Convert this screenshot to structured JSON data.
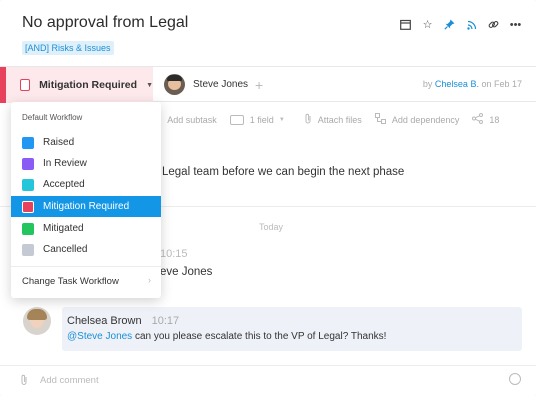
{
  "task": {
    "title": "No approval from Legal",
    "tag": "[AND] Risks & Issues",
    "description": "Legal team before we can begin the next phase"
  },
  "header_icons": [
    "calendar-icon",
    "star-icon",
    "pin-icon",
    "rss-icon",
    "link-icon",
    "more-icon"
  ],
  "status": {
    "label": "Mitigation Required",
    "color": "#e8415b"
  },
  "assignee": {
    "name": "Steve Jones"
  },
  "meta": {
    "prefix": "by",
    "author": "Chelsea B.",
    "date": "on Feb 17"
  },
  "toolbar": {
    "add_subtask": "Add subtask",
    "files": "1 field",
    "attach": "Attach files",
    "dependency": "Add dependency",
    "count": "18"
  },
  "dropdown": {
    "heading": "Default Workflow",
    "options": [
      {
        "label": "Raised",
        "color": "#2196f3"
      },
      {
        "label": "In Review",
        "color": "#8a5cf5"
      },
      {
        "label": "Accepted",
        "color": "#26c6da"
      },
      {
        "label": "Mitigation Required",
        "color": "#e8415b"
      },
      {
        "label": "Mitigated",
        "color": "#22c55e"
      },
      {
        "label": "Cancelled",
        "color": "#c4c9d4"
      }
    ],
    "change": "Change Task Workflow"
  },
  "timeline": {
    "day_label": "Today",
    "prev_time": "10:15",
    "prev_name": "eve Jones"
  },
  "comment": {
    "author": "Chelsea Brown",
    "time": "10:17",
    "mention": "@Steve Jones",
    "text": " can you please escalate this to the VP of Legal? Thanks!"
  },
  "composer": {
    "placeholder": "Add comment"
  }
}
